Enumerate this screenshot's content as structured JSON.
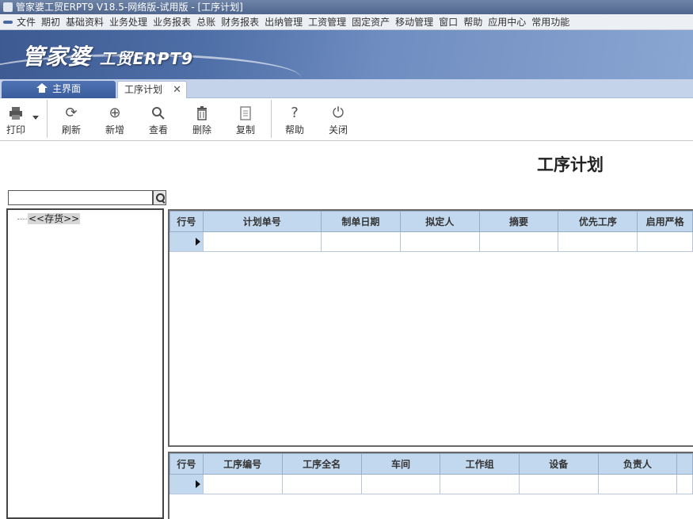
{
  "window": {
    "title": "管家婆工贸ERPT9 V18.5-网络版-试用版 - [工序计划]"
  },
  "menu": [
    "文件",
    "期初",
    "基础资料",
    "业务处理",
    "业务报表",
    "总账",
    "财务报表",
    "出纳管理",
    "工资管理",
    "固定资产",
    "移动管理",
    "窗口",
    "帮助",
    "应用中心",
    "常用功能"
  ],
  "banner": {
    "logo": "管家婆",
    "logo_sub": "工贸ERP",
    "logo_ver": "T9"
  },
  "tabs": {
    "home": "主界面",
    "active": "工序计划",
    "close": "✕"
  },
  "toolbar": {
    "print": "打印",
    "refresh": "刷新",
    "add": "新增",
    "view": "查看",
    "delete": "删除",
    "copy": "复制",
    "help": "帮助",
    "close": "关闭"
  },
  "page": {
    "title": "工序计划"
  },
  "tree": {
    "root": "<<存货>>"
  },
  "plan_table": {
    "headers": [
      "行号",
      "计划单号",
      "制单日期",
      "拟定人",
      "摘要",
      "优先工序",
      "启用严格"
    ]
  },
  "process_table": {
    "headers": [
      "行号",
      "工序编号",
      "工序全名",
      "车间",
      "工作组",
      "设备",
      "负责人"
    ]
  },
  "colors": {
    "header_bg": "#c2d8ee",
    "tab_active": "#3a5c9c",
    "banner": "#4f6fa8"
  }
}
